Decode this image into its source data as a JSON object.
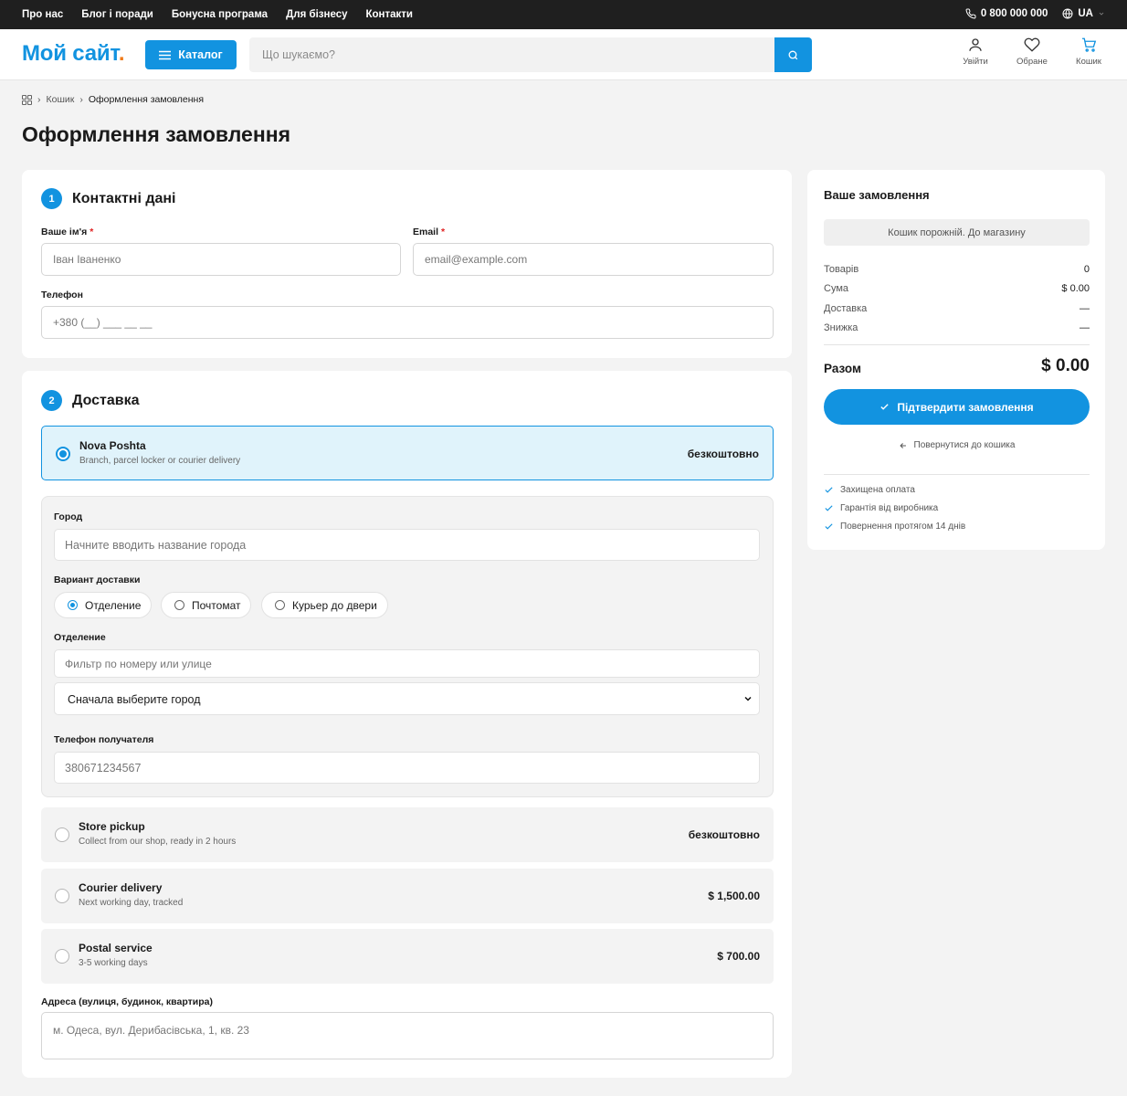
{
  "topbar": {
    "links": [
      "Про нас",
      "Блог і поради",
      "Бонусна програма",
      "Для бізнесу",
      "Контакти"
    ],
    "phone": "0 800 000 000",
    "lang": "UA"
  },
  "header": {
    "logo_text": "Мой сайт",
    "logo_dot": ".",
    "catalog_label": "Каталог",
    "search_placeholder": "Що шукаємо?",
    "icons": {
      "login": "Увійти",
      "favorites": "Обране",
      "cart": "Кошик"
    }
  },
  "breadcrumb": {
    "cart": "Кошик",
    "current": "Оформлення замовлення"
  },
  "page_title": "Оформлення замовлення",
  "contacts": {
    "step": "1",
    "title": "Контактні дані",
    "name_label": "Ваше ім'я",
    "name_placeholder": "Іван Іваненко",
    "email_label": "Email",
    "email_placeholder": "email@example.com",
    "phone_label": "Телефон",
    "phone_placeholder": "+380 (__) ___ __ __",
    "required_mark": "*"
  },
  "delivery": {
    "step": "2",
    "title": "Доставка",
    "options": [
      {
        "name": "Nova Poshta",
        "desc": "Branch, parcel locker or courier delivery",
        "price": "безкоштовно",
        "selected": true
      },
      {
        "name": "Store pickup",
        "desc": "Collect from our shop, ready in 2 hours",
        "price": "безкоштовно",
        "selected": false
      },
      {
        "name": "Courier delivery",
        "desc": "Next working day, tracked",
        "price": "$ 1,500.00",
        "selected": false
      },
      {
        "name": "Postal service",
        "desc": "3-5 working days",
        "price": "$ 700.00",
        "selected": false
      }
    ],
    "np": {
      "city_label": "Город",
      "city_placeholder": "Начните вводить название города",
      "variant_label": "Вариант доставки",
      "variants": [
        "Отделение",
        "Почтомат",
        "Курьер до двери"
      ],
      "selected_variant": "Отделение",
      "branch_label": "Отделение",
      "branch_filter_placeholder": "Фильтр по номеру или улице",
      "branch_select_value": "Сначала выберите город",
      "recipient_phone_label": "Телефон получателя",
      "recipient_phone_placeholder": "380671234567"
    },
    "address_label": "Адреса (вулиця, будинок, квартира)",
    "address_placeholder": "м. Одеса, вул. Дерибасівська, 1, кв. 23"
  },
  "summary": {
    "title": "Ваше замовлення",
    "empty_cart": "Кошик порожній. До магазину",
    "rows": [
      {
        "label": "Товарів",
        "value": "0"
      },
      {
        "label": "Сума",
        "value": "$ 0.00"
      },
      {
        "label": "Доставка",
        "value": "—"
      },
      {
        "label": "Знижка",
        "value": "—"
      }
    ],
    "total_label": "Разом",
    "total_value": "$ 0.00",
    "confirm_label": "Підтвердити замовлення",
    "back_label": "Повернутися до кошика",
    "perks": [
      "Захищена оплата",
      "Гарантія від виробника",
      "Повернення протягом 14 днів"
    ]
  },
  "colors": {
    "accent": "#1293e0",
    "logo_dot": "#f07a1a",
    "required": "#e02020",
    "topbar_bg": "#1f1f1f"
  }
}
